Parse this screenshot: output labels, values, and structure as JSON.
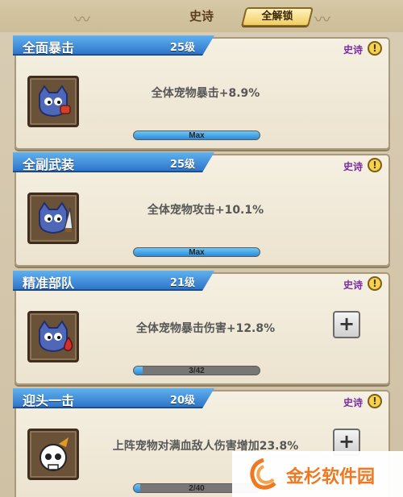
{
  "header": {
    "title": "史诗",
    "unlock_all_label": "全解锁"
  },
  "colors": {
    "ribbon_blue": "#2f75c9",
    "progress_blue": "#2b8ad8",
    "rarity_purple": "#7a2ea1"
  },
  "cards": [
    {
      "name": "全面暴击",
      "level": "25级",
      "rarity": "史诗",
      "icon": "crimson-fist-creature-icon",
      "effect": "全体宠物暴击+8.9%",
      "progress_label": "Max",
      "progress": 1.0,
      "has_plus": false
    },
    {
      "name": "全副武装",
      "level": "25级",
      "rarity": "史诗",
      "icon": "sword-creature-icon",
      "effect": "全体宠物攻击+10.1%",
      "progress_label": "Max",
      "progress": 1.0,
      "has_plus": false
    },
    {
      "name": "精准部队",
      "level": "21级",
      "rarity": "史诗",
      "icon": "blood-drop-creature-icon",
      "effect": "全体宠物暴击伤害+12.8%",
      "progress_label": "3/42",
      "progress": 0.07,
      "has_plus": true
    },
    {
      "name": "迎头一击",
      "level": "20级",
      "rarity": "史诗",
      "icon": "skull-icon",
      "effect": "上阵宠物对满血敌人伤害增加23.8%",
      "progress_label": "2/40",
      "progress": 0.05,
      "has_plus": true
    }
  ],
  "watermark": {
    "text": "金杉软件园"
  }
}
